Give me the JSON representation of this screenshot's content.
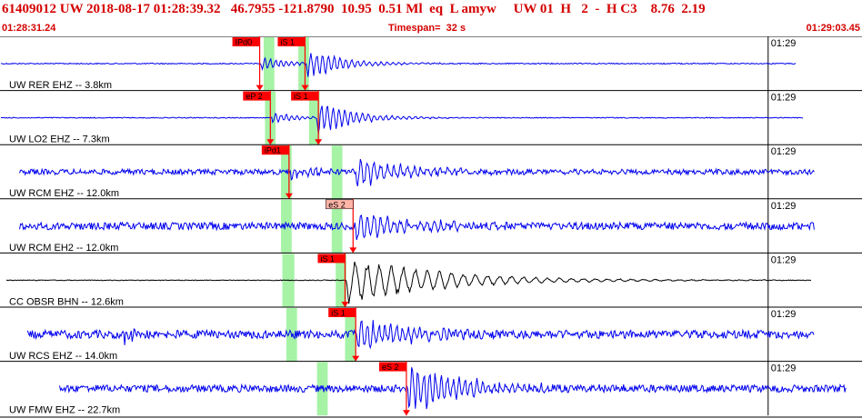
{
  "header": {
    "title": "61409012 UW 2018-08-17 01:28:39.32   46.7955 -121.8790  10.95  0.51 Ml  eq  L amyw     UW 01  H   2  -  H C3    8.76  2.19",
    "start_time": "01:28:31.24",
    "timespan": "Timespan=  32 s",
    "end_time": "01:29:03.45"
  },
  "chart_data": {
    "type": "line",
    "description_units": "seconds from 01:28:31.24",
    "xlim": [
      0,
      32.21
    ],
    "time_tick_label": "01:29",
    "time_tick_seconds": 28.76,
    "colors": {
      "trace_short_period": "#0000ee",
      "trace_broadband": "#000000",
      "pick": "#ff0000",
      "pick_label_bg": "#ff0000",
      "pick_alt_bg": "#ffb4a8",
      "window": "#a6f3a6",
      "text": "#d40000"
    },
    "traces": [
      {
        "label": "UW RER EHZ -- 3.8km",
        "color": "#0000ee",
        "data_start": 0.0,
        "data_end": 29.8,
        "noise": 0.6,
        "windows": [
          [
            9.85,
            10.25
          ],
          [
            11.15,
            11.55
          ]
        ],
        "picks": [
          {
            "label": "IPd0",
            "t": 9.7,
            "style": "red"
          },
          {
            "label": "iS 1",
            "t": 11.4,
            "style": "red"
          }
        ],
        "events": [
          {
            "t": 9.75,
            "amp": 6,
            "decay": 1.2,
            "period": 0.2
          },
          {
            "t": 11.45,
            "amp": 15,
            "decay": 1.3,
            "period": 0.22
          }
        ]
      },
      {
        "label": "UW LO2 EHZ -- 7.3km",
        "color": "#0000ee",
        "data_start": 0.0,
        "data_end": 30.1,
        "noise": 0.5,
        "windows": [
          [
            9.9,
            10.3
          ],
          [
            11.55,
            11.95
          ]
        ],
        "picks": [
          {
            "label": "eP 2",
            "t": 10.1,
            "style": "red"
          },
          {
            "label": "iS 1",
            "t": 11.9,
            "style": "red"
          }
        ],
        "events": [
          {
            "t": 10.15,
            "amp": 5,
            "decay": 1.0,
            "period": 0.2
          },
          {
            "t": 11.85,
            "amp": 16,
            "decay": 1.4,
            "period": 0.22
          }
        ]
      },
      {
        "label": "UW RCM EHZ -- 12.0km",
        "color": "#0000ee",
        "data_start": 0.7,
        "data_end": 30.5,
        "noise": 3.0,
        "windows": [
          [
            10.5,
            10.9
          ],
          [
            12.4,
            12.8
          ]
        ],
        "picks": [
          {
            "label": "iPd1",
            "t": 10.8,
            "style": "red"
          }
        ],
        "events": [
          {
            "t": 10.85,
            "amp": 6,
            "decay": 1.2,
            "period": 0.2
          },
          {
            "t": 13.3,
            "amp": 14,
            "decay": 1.8,
            "period": 0.25
          }
        ]
      },
      {
        "label": "UW RCM EH2 -- 12.0km",
        "color": "#0000ee",
        "data_start": 0.7,
        "data_end": 30.5,
        "noise": 4.0,
        "windows": [
          [
            10.5,
            10.9
          ],
          [
            12.4,
            12.8
          ]
        ],
        "picks": [
          {
            "label": "eS 2",
            "t": 13.2,
            "style": "alt"
          }
        ],
        "events": [
          {
            "t": 13.3,
            "amp": 15,
            "decay": 1.9,
            "period": 0.25
          }
        ]
      },
      {
        "label": "CC OBSR BHN -- 12.6km",
        "color": "#000000",
        "data_start": 0.2,
        "data_end": 30.4,
        "noise": 0.4,
        "windows": [
          [
            10.55,
            11.0
          ],
          [
            12.55,
            12.95
          ]
        ],
        "picks": [
          {
            "label": "iS 1",
            "t": 12.9,
            "style": "red"
          }
        ],
        "events": [
          {
            "t": 12.95,
            "amp": 22,
            "decay": 3.5,
            "period": 0.45
          }
        ]
      },
      {
        "label": "UW RCS EHZ -- 14.0km",
        "color": "#0000ee",
        "data_start": 1.0,
        "data_end": 30.5,
        "noise": 4.5,
        "windows": [
          [
            10.7,
            11.1
          ],
          [
            12.9,
            13.3
          ]
        ],
        "picks": [
          {
            "label": "iS 1",
            "t": 13.3,
            "style": "red"
          }
        ],
        "events": [
          {
            "t": 13.35,
            "amp": 18,
            "decay": 1.8,
            "period": 0.22
          },
          {
            "t": 4.6,
            "amp": 11,
            "decay": 0.4,
            "period": 0.15
          }
        ]
      },
      {
        "label": "UW FMW EHZ -- 22.7km",
        "color": "#0000ee",
        "data_start": 2.2,
        "data_end": 31.7,
        "noise": 4.0,
        "windows": [
          [
            11.85,
            12.25
          ]
        ],
        "picks": [
          {
            "label": "eS 2",
            "t": 15.2,
            "style": "red"
          }
        ],
        "events": [
          {
            "t": 15.25,
            "amp": 22,
            "decay": 2.2,
            "period": 0.22
          }
        ]
      }
    ]
  }
}
